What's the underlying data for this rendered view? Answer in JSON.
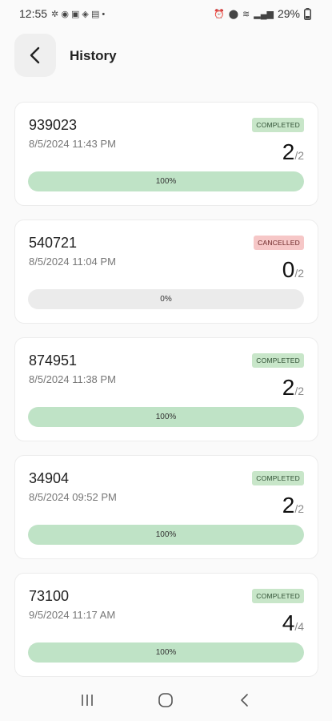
{
  "status_bar": {
    "time": "12:55",
    "battery": "29%"
  },
  "header": {
    "title": "History"
  },
  "orders": [
    {
      "id": "939023",
      "date": "8/5/2024 11:43 PM",
      "status": "COMPLETED",
      "done": "2",
      "total": "2",
      "progress_label": "100%",
      "progress": 1.0
    },
    {
      "id": "540721",
      "date": "8/5/2024 11:04 PM",
      "status": "CANCELLED",
      "done": "0",
      "total": "2",
      "progress_label": "0%",
      "progress": 0.0
    },
    {
      "id": "874951",
      "date": "8/5/2024 11:38 PM",
      "status": "COMPLETED",
      "done": "2",
      "total": "2",
      "progress_label": "100%",
      "progress": 1.0
    },
    {
      "id": "34904",
      "date": "8/5/2024 09:52 PM",
      "status": "COMPLETED",
      "done": "2",
      "total": "2",
      "progress_label": "100%",
      "progress": 1.0
    },
    {
      "id": "73100",
      "date": "9/5/2024 11:17 AM",
      "status": "COMPLETED",
      "done": "4",
      "total": "4",
      "progress_label": "100%",
      "progress": 1.0
    }
  ],
  "colors": {
    "completed_badge": "#c8e6c9",
    "cancelled_badge": "#f6c7c7",
    "progress_fill": "#bfe3c6",
    "progress_track": "#ebebeb"
  },
  "icons": {
    "back": "chevron-left-icon",
    "nav_recents": "recents-icon",
    "nav_home": "home-icon",
    "nav_back": "back-icon"
  }
}
